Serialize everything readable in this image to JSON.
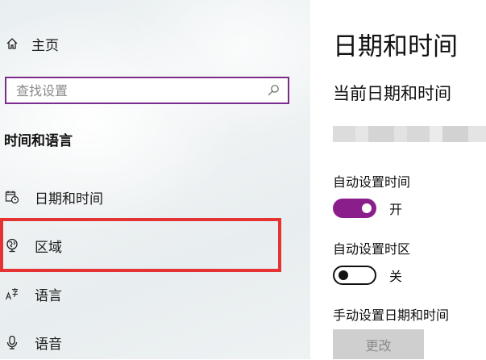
{
  "sidebar": {
    "home": {
      "label": "主页",
      "icon": "home-icon"
    },
    "search": {
      "placeholder": "查找设置",
      "icon": "search-icon"
    },
    "section_title": "时间和语言",
    "items": [
      {
        "label": "日期和时间",
        "icon": "calendar-clock-icon"
      },
      {
        "label": "区域",
        "icon": "globe-region-icon"
      },
      {
        "label": "语言",
        "icon": "language-icon"
      },
      {
        "label": "语音",
        "icon": "microphone-icon"
      }
    ],
    "highlight_color": "#e53333",
    "search_border_color": "#7d2b8c"
  },
  "main": {
    "title": "日期和时间",
    "subtitle": "当前日期和时间",
    "settings": {
      "auto_time": {
        "label": "自动设置时间",
        "state": "开",
        "on": true
      },
      "auto_zone": {
        "label": "自动设置时区",
        "state": "关",
        "on": false
      },
      "manual": {
        "label": "手动设置日期和时间",
        "button": "更改",
        "button_enabled": false
      }
    },
    "accent_color": "#8a1f8c"
  }
}
